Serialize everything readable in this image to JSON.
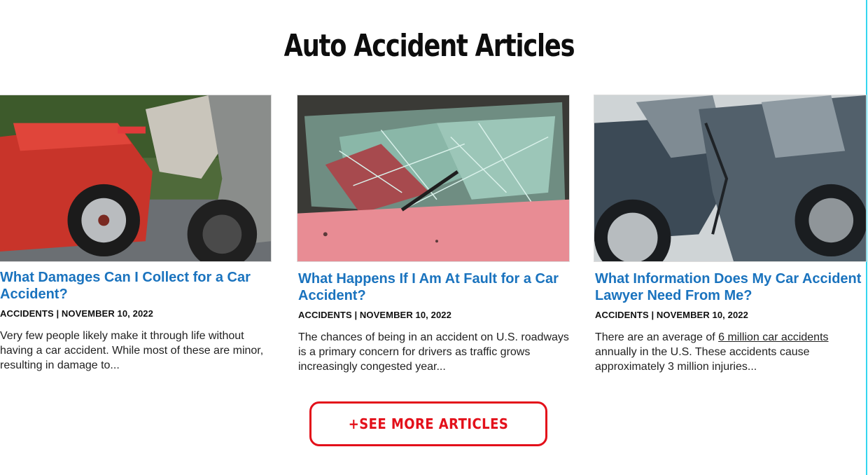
{
  "section": {
    "title": "Auto Accident Articles"
  },
  "articles": [
    {
      "title": "What Damages Can I Collect for a Car Accident?",
      "meta": "ACCIDENTS | NOVEMBER 10, 2022",
      "excerpt": "Very few people likely make it through life without having a car accident. While most of these are minor, resulting in damage to...",
      "image_icon": "wrecked-red-car-photo"
    },
    {
      "title": "What Happens If I Am At Fault for a Car Accident?",
      "meta": "ACCIDENTS | NOVEMBER 10, 2022",
      "excerpt": "The chances of being in an accident on U.S. roadways is a primary concern for drivers as traffic grows increasingly congested year...",
      "image_icon": "shattered-windshield-photo"
    },
    {
      "title": "What Information Does My Car Accident Lawyer Need From Me?",
      "meta": "ACCIDENTS | NOVEMBER 10, 2022",
      "excerpt_before": "There are an average of ",
      "excerpt_link": "6 million car accidents",
      "excerpt_after": " annually in the U.S. These accidents cause approximately 3 million injuries...",
      "image_icon": "crashed-cars-photo"
    }
  ],
  "more_button": {
    "label": "+SEE MORE ARTICLES"
  },
  "colors": {
    "title_link": "#1a73be",
    "accent_red": "#e3101a",
    "border_cyan": "#33d6f0"
  }
}
